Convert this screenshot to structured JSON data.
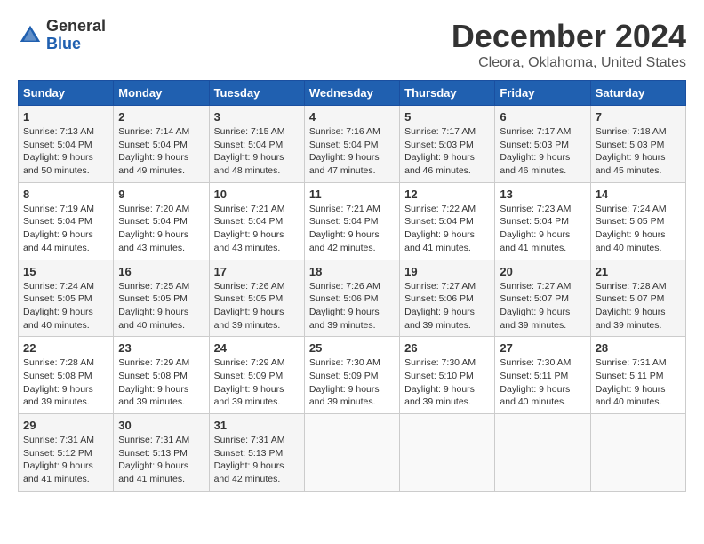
{
  "logo": {
    "text_general": "General",
    "text_blue": "Blue"
  },
  "title": "December 2024",
  "subtitle": "Cleora, Oklahoma, United States",
  "days_of_week": [
    "Sunday",
    "Monday",
    "Tuesday",
    "Wednesday",
    "Thursday",
    "Friday",
    "Saturday"
  ],
  "weeks": [
    [
      {
        "day": "1",
        "sunrise": "Sunrise: 7:13 AM",
        "sunset": "Sunset: 5:04 PM",
        "daylight": "Daylight: 9 hours and 50 minutes."
      },
      {
        "day": "2",
        "sunrise": "Sunrise: 7:14 AM",
        "sunset": "Sunset: 5:04 PM",
        "daylight": "Daylight: 9 hours and 49 minutes."
      },
      {
        "day": "3",
        "sunrise": "Sunrise: 7:15 AM",
        "sunset": "Sunset: 5:04 PM",
        "daylight": "Daylight: 9 hours and 48 minutes."
      },
      {
        "day": "4",
        "sunrise": "Sunrise: 7:16 AM",
        "sunset": "Sunset: 5:04 PM",
        "daylight": "Daylight: 9 hours and 47 minutes."
      },
      {
        "day": "5",
        "sunrise": "Sunrise: 7:17 AM",
        "sunset": "Sunset: 5:03 PM",
        "daylight": "Daylight: 9 hours and 46 minutes."
      },
      {
        "day": "6",
        "sunrise": "Sunrise: 7:17 AM",
        "sunset": "Sunset: 5:03 PM",
        "daylight": "Daylight: 9 hours and 46 minutes."
      },
      {
        "day": "7",
        "sunrise": "Sunrise: 7:18 AM",
        "sunset": "Sunset: 5:03 PM",
        "daylight": "Daylight: 9 hours and 45 minutes."
      }
    ],
    [
      {
        "day": "8",
        "sunrise": "Sunrise: 7:19 AM",
        "sunset": "Sunset: 5:04 PM",
        "daylight": "Daylight: 9 hours and 44 minutes."
      },
      {
        "day": "9",
        "sunrise": "Sunrise: 7:20 AM",
        "sunset": "Sunset: 5:04 PM",
        "daylight": "Daylight: 9 hours and 43 minutes."
      },
      {
        "day": "10",
        "sunrise": "Sunrise: 7:21 AM",
        "sunset": "Sunset: 5:04 PM",
        "daylight": "Daylight: 9 hours and 43 minutes."
      },
      {
        "day": "11",
        "sunrise": "Sunrise: 7:21 AM",
        "sunset": "Sunset: 5:04 PM",
        "daylight": "Daylight: 9 hours and 42 minutes."
      },
      {
        "day": "12",
        "sunrise": "Sunrise: 7:22 AM",
        "sunset": "Sunset: 5:04 PM",
        "daylight": "Daylight: 9 hours and 41 minutes."
      },
      {
        "day": "13",
        "sunrise": "Sunrise: 7:23 AM",
        "sunset": "Sunset: 5:04 PM",
        "daylight": "Daylight: 9 hours and 41 minutes."
      },
      {
        "day": "14",
        "sunrise": "Sunrise: 7:24 AM",
        "sunset": "Sunset: 5:05 PM",
        "daylight": "Daylight: 9 hours and 40 minutes."
      }
    ],
    [
      {
        "day": "15",
        "sunrise": "Sunrise: 7:24 AM",
        "sunset": "Sunset: 5:05 PM",
        "daylight": "Daylight: 9 hours and 40 minutes."
      },
      {
        "day": "16",
        "sunrise": "Sunrise: 7:25 AM",
        "sunset": "Sunset: 5:05 PM",
        "daylight": "Daylight: 9 hours and 40 minutes."
      },
      {
        "day": "17",
        "sunrise": "Sunrise: 7:26 AM",
        "sunset": "Sunset: 5:05 PM",
        "daylight": "Daylight: 9 hours and 39 minutes."
      },
      {
        "day": "18",
        "sunrise": "Sunrise: 7:26 AM",
        "sunset": "Sunset: 5:06 PM",
        "daylight": "Daylight: 9 hours and 39 minutes."
      },
      {
        "day": "19",
        "sunrise": "Sunrise: 7:27 AM",
        "sunset": "Sunset: 5:06 PM",
        "daylight": "Daylight: 9 hours and 39 minutes."
      },
      {
        "day": "20",
        "sunrise": "Sunrise: 7:27 AM",
        "sunset": "Sunset: 5:07 PM",
        "daylight": "Daylight: 9 hours and 39 minutes."
      },
      {
        "day": "21",
        "sunrise": "Sunrise: 7:28 AM",
        "sunset": "Sunset: 5:07 PM",
        "daylight": "Daylight: 9 hours and 39 minutes."
      }
    ],
    [
      {
        "day": "22",
        "sunrise": "Sunrise: 7:28 AM",
        "sunset": "Sunset: 5:08 PM",
        "daylight": "Daylight: 9 hours and 39 minutes."
      },
      {
        "day": "23",
        "sunrise": "Sunrise: 7:29 AM",
        "sunset": "Sunset: 5:08 PM",
        "daylight": "Daylight: 9 hours and 39 minutes."
      },
      {
        "day": "24",
        "sunrise": "Sunrise: 7:29 AM",
        "sunset": "Sunset: 5:09 PM",
        "daylight": "Daylight: 9 hours and 39 minutes."
      },
      {
        "day": "25",
        "sunrise": "Sunrise: 7:30 AM",
        "sunset": "Sunset: 5:09 PM",
        "daylight": "Daylight: 9 hours and 39 minutes."
      },
      {
        "day": "26",
        "sunrise": "Sunrise: 7:30 AM",
        "sunset": "Sunset: 5:10 PM",
        "daylight": "Daylight: 9 hours and 39 minutes."
      },
      {
        "day": "27",
        "sunrise": "Sunrise: 7:30 AM",
        "sunset": "Sunset: 5:11 PM",
        "daylight": "Daylight: 9 hours and 40 minutes."
      },
      {
        "day": "28",
        "sunrise": "Sunrise: 7:31 AM",
        "sunset": "Sunset: 5:11 PM",
        "daylight": "Daylight: 9 hours and 40 minutes."
      }
    ],
    [
      {
        "day": "29",
        "sunrise": "Sunrise: 7:31 AM",
        "sunset": "Sunset: 5:12 PM",
        "daylight": "Daylight: 9 hours and 41 minutes."
      },
      {
        "day": "30",
        "sunrise": "Sunrise: 7:31 AM",
        "sunset": "Sunset: 5:13 PM",
        "daylight": "Daylight: 9 hours and 41 minutes."
      },
      {
        "day": "31",
        "sunrise": "Sunrise: 7:31 AM",
        "sunset": "Sunset: 5:13 PM",
        "daylight": "Daylight: 9 hours and 42 minutes."
      },
      null,
      null,
      null,
      null
    ]
  ]
}
